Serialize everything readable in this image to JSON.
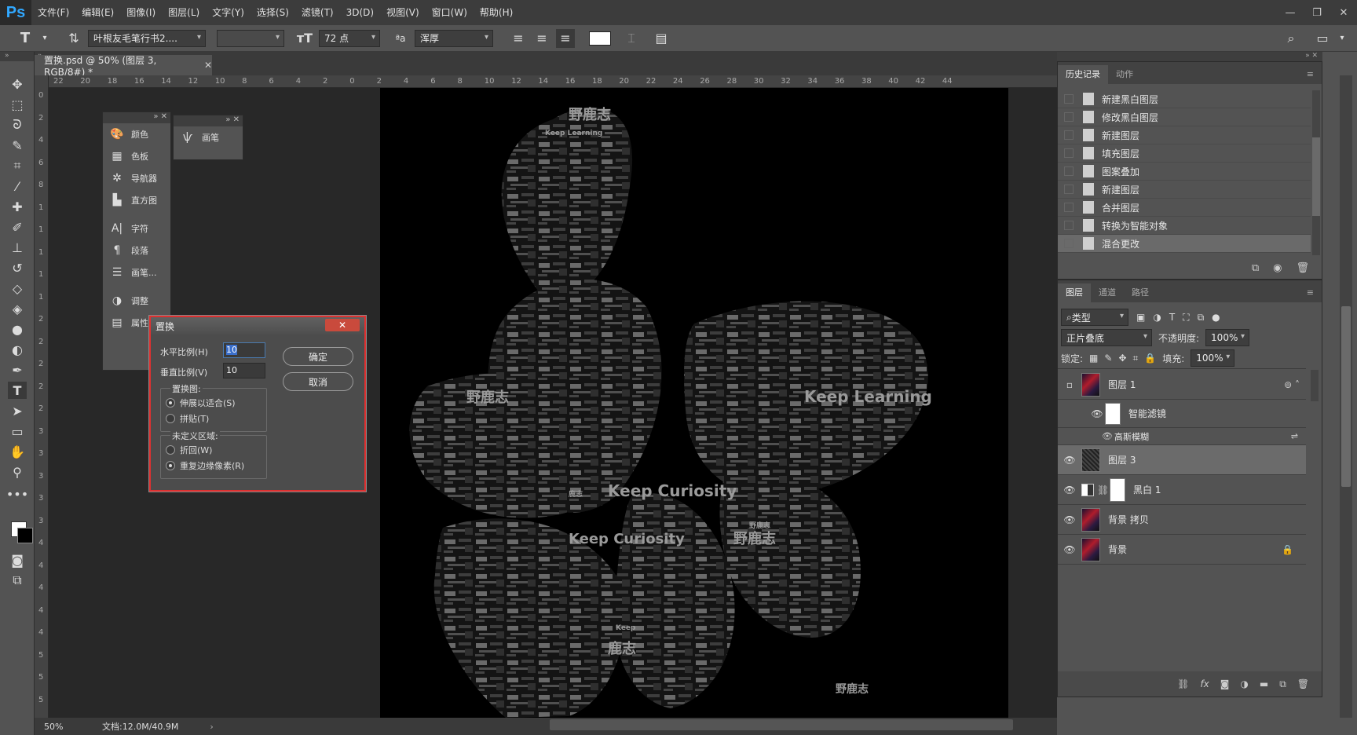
{
  "app": {
    "logo": "Ps"
  },
  "menu": [
    "文件(F)",
    "编辑(E)",
    "图像(I)",
    "图层(L)",
    "文字(Y)",
    "选择(S)",
    "滤镜(T)",
    "3D(D)",
    "视图(V)",
    "窗口(W)",
    "帮助(H)"
  ],
  "window_controls": {
    "minimize": "—",
    "restore": "❐",
    "close": "✕"
  },
  "options": {
    "tool_glyph": "T",
    "font_family": "叶根友毛笔行书2....",
    "font_size": "72 点",
    "aa_label": "ªa",
    "aa_mode": "浑厚"
  },
  "document": {
    "tab_title": "置换.psd @ 50% (图层 3, RGB/8#) *",
    "zoom": "50%",
    "doc_info": "文档:12.0M/40.9M"
  },
  "hruler": [
    "22",
    "20",
    "18",
    "16",
    "14",
    "12",
    "10",
    "8",
    "6",
    "4",
    "2",
    "0",
    "2",
    "4",
    "6",
    "8",
    "10",
    "12",
    "14",
    "16",
    "18",
    "20",
    "22",
    "24",
    "26",
    "28",
    "30",
    "32",
    "34",
    "36",
    "38",
    "40",
    "42",
    "44"
  ],
  "vruler": [
    "0",
    "2",
    "4",
    "6",
    "8",
    "1",
    "1",
    "1",
    "1",
    "1",
    "2",
    "2",
    "2",
    "2",
    "2",
    "3",
    "3",
    "3",
    "3",
    "3",
    "4",
    "4",
    "4",
    "4",
    "4",
    "5",
    "5",
    "5"
  ],
  "panel_dock1": [
    {
      "icon": "palette-icon",
      "glyph": "🎨",
      "label": "颜色"
    },
    {
      "icon": "swatches-icon",
      "glyph": "▦",
      "label": "色板"
    },
    {
      "icon": "navigator-icon",
      "glyph": "✲",
      "label": "导航器"
    },
    {
      "icon": "histogram-icon",
      "glyph": "▙",
      "label": "直方图"
    },
    {
      "icon": "character-icon",
      "glyph": "A|",
      "label": "字符"
    },
    {
      "icon": "paragraph-icon",
      "glyph": "¶",
      "label": "段落"
    },
    {
      "icon": "brush-presets-icon",
      "glyph": "☰",
      "label": "画笔..."
    },
    {
      "icon": "adjustments-icon",
      "glyph": "◑",
      "label": "调整"
    },
    {
      "icon": "properties-icon",
      "glyph": "▤",
      "label": "属性"
    }
  ],
  "panel_dock2": {
    "glyph": "ѱ",
    "label": "画笔"
  },
  "dialog": {
    "title": "置换",
    "close": "✕",
    "h_label": "水平比例(H)",
    "h_value": "10",
    "v_label": "垂直比例(V)",
    "v_value": "10",
    "ok": "确定",
    "cancel": "取消",
    "map_group": "置换图:",
    "map_opt1": "伸展以适合(S)",
    "map_opt2": "拼贴(T)",
    "undef_group": "未定义区域:",
    "undef_opt1": "折回(W)",
    "undef_opt2": "重复边缘像素(R)"
  },
  "history": {
    "tabs": [
      "历史记录",
      "动作"
    ],
    "items": [
      "新建黑白图层",
      "修改黑白图层",
      "新建图层",
      "填充图层",
      "图案叠加",
      "新建图层",
      "合并图层",
      "转换为智能对象",
      "混合更改"
    ]
  },
  "layers": {
    "tabs": [
      "图层",
      "通道",
      "路径"
    ],
    "filter_kind": "类型",
    "blend_mode": "正片叠底",
    "opacity_label": "不透明度:",
    "opacity": "100%",
    "lock_label": "锁定:",
    "fill_label": "填充:",
    "fill": "100%",
    "rows": [
      {
        "name": "图层 1"
      },
      {
        "name": "智能滤镜"
      },
      {
        "name": "高斯模糊"
      },
      {
        "name": "图层 3"
      },
      {
        "name": "黑白 1"
      },
      {
        "name": "背景 拷贝"
      },
      {
        "name": "背景"
      }
    ]
  },
  "canvas_words": [
    "野鹿志",
    "Keep Learning",
    "Keep Curiosity",
    "鹿志",
    "野鹿志",
    "Keep Learning",
    "野鹿志",
    "Keep Curiosity",
    "野鹿志",
    "鹿志",
    "Keep",
    "野鹿志"
  ]
}
